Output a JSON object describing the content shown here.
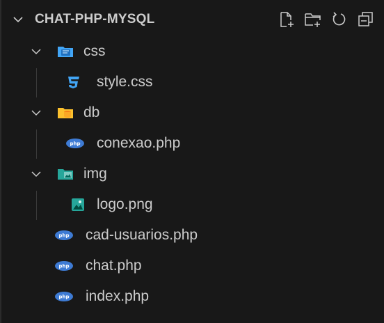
{
  "explorer": {
    "title": "CHAT-PHP-MYSQL",
    "actions": [
      {
        "name": "new-file-icon"
      },
      {
        "name": "new-folder-icon"
      },
      {
        "name": "refresh-icon"
      },
      {
        "name": "collapse-all-icon"
      }
    ]
  },
  "tree": {
    "css_folder": "css",
    "style_file": "style.css",
    "db_folder": "db",
    "conexao_file": "conexao.php",
    "img_folder": "img",
    "logo_file": "logo.png",
    "cad_file": "cad-usuarios.php",
    "chat_file": "chat.php",
    "index_file": "index.php"
  },
  "colors": {
    "background": "#181818",
    "text": "#cccccc",
    "css_icon": "#42a5f5",
    "db_folder": "#fbc02d",
    "img_folder": "#26a69a",
    "php_icon": "#3e7bd4",
    "png_icon": "#26a69a"
  }
}
